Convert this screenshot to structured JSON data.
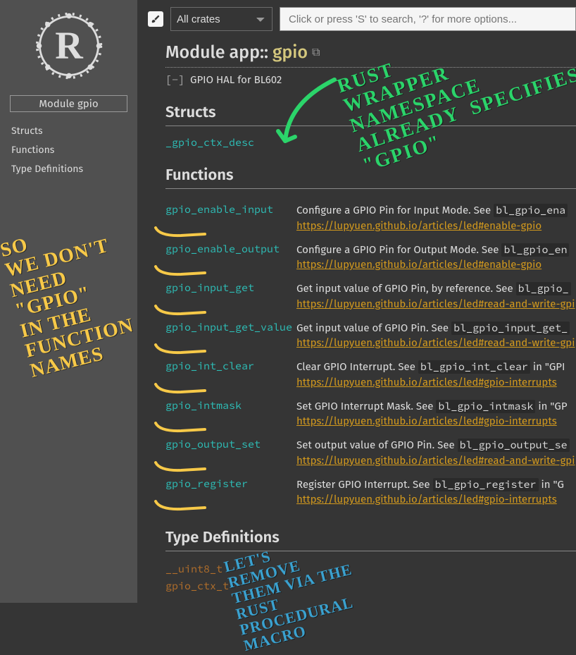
{
  "sidebar": {
    "header": "Module gpio",
    "links": [
      "Structs",
      "Functions",
      "Type Definitions"
    ]
  },
  "topbar": {
    "theme_icon": "brush-icon",
    "crate_selected": "All crates",
    "search_placeholder": "Click or press 'S' to search, '?' for more options..."
  },
  "heading": {
    "prefix": "Module ",
    "path": "app::",
    "name": "gpio"
  },
  "summary": {
    "toggle": "[−]",
    "text": "GPIO HAL for BL602"
  },
  "sections": {
    "structs": "Structs",
    "functions": "Functions",
    "typedefs": "Type Definitions"
  },
  "structs": [
    {
      "name": "_gpio_ctx_desc"
    }
  ],
  "functions": [
    {
      "name": "gpio_enable_input",
      "desc": "Configure a GPIO Pin for Input Mode. See ",
      "code": "bl_gpio_ena",
      "url": "https://lupyuen.github.io/articles/led#enable-gpio"
    },
    {
      "name": "gpio_enable_output",
      "desc": "Configure a GPIO Pin for Output Mode. See ",
      "code": "bl_gpio_en",
      "url": "https://lupyuen.github.io/articles/led#enable-gpio"
    },
    {
      "name": "gpio_input_get",
      "desc": "Get input value of GPIO Pin, by reference. See ",
      "code": "bl_gpio_",
      "url": "https://lupyuen.github.io/articles/led#read-and-write-gpi"
    },
    {
      "name": "gpio_input_get_value",
      "desc": "Get input value of GPIO Pin. See ",
      "code": "bl_gpio_input_get_",
      "url": "https://lupyuen.github.io/articles/led#read-and-write-gpi"
    },
    {
      "name": "gpio_int_clear",
      "desc": "Clear GPIO Interrupt. See ",
      "code": "bl_gpio_int_clear",
      "tail": " in \"GPI",
      "url": "https://lupyuen.github.io/articles/led#gpio-interrupts"
    },
    {
      "name": "gpio_intmask",
      "desc": "Set GPIO Interrupt Mask. See ",
      "code": "bl_gpio_intmask",
      "tail": " in \"GP",
      "url": "https://lupyuen.github.io/articles/led#gpio-interrupts"
    },
    {
      "name": "gpio_output_set",
      "desc": "Set output value of GPIO Pin. See ",
      "code": "bl_gpio_output_se",
      "url": "https://lupyuen.github.io/articles/led#read-and-write-gpi"
    },
    {
      "name": "gpio_register",
      "desc": "Register GPIO Interrupt. See ",
      "code": "bl_gpio_register",
      "tail": " in \"G",
      "url": "https://lupyuen.github.io/articles/led#gpio-interrupts"
    }
  ],
  "typedefs": [
    {
      "name": "__uint8_t"
    },
    {
      "name": "gpio_ctx_t"
    }
  ],
  "annotations": {
    "green": "RUST\nWRAPPER\nNAMESPACE\nALREADY  SPECIFIES\n\"GPIO\"",
    "yellow": "SO\nWE DON'T\nNEED\n\"GPIO\"\nIN THE\nFUNCTION\nNAMES",
    "blue": "LET'S\nREMOVE\nTHEM VIA THE\nRUST\nPROCEDURAL\nMACRO"
  }
}
